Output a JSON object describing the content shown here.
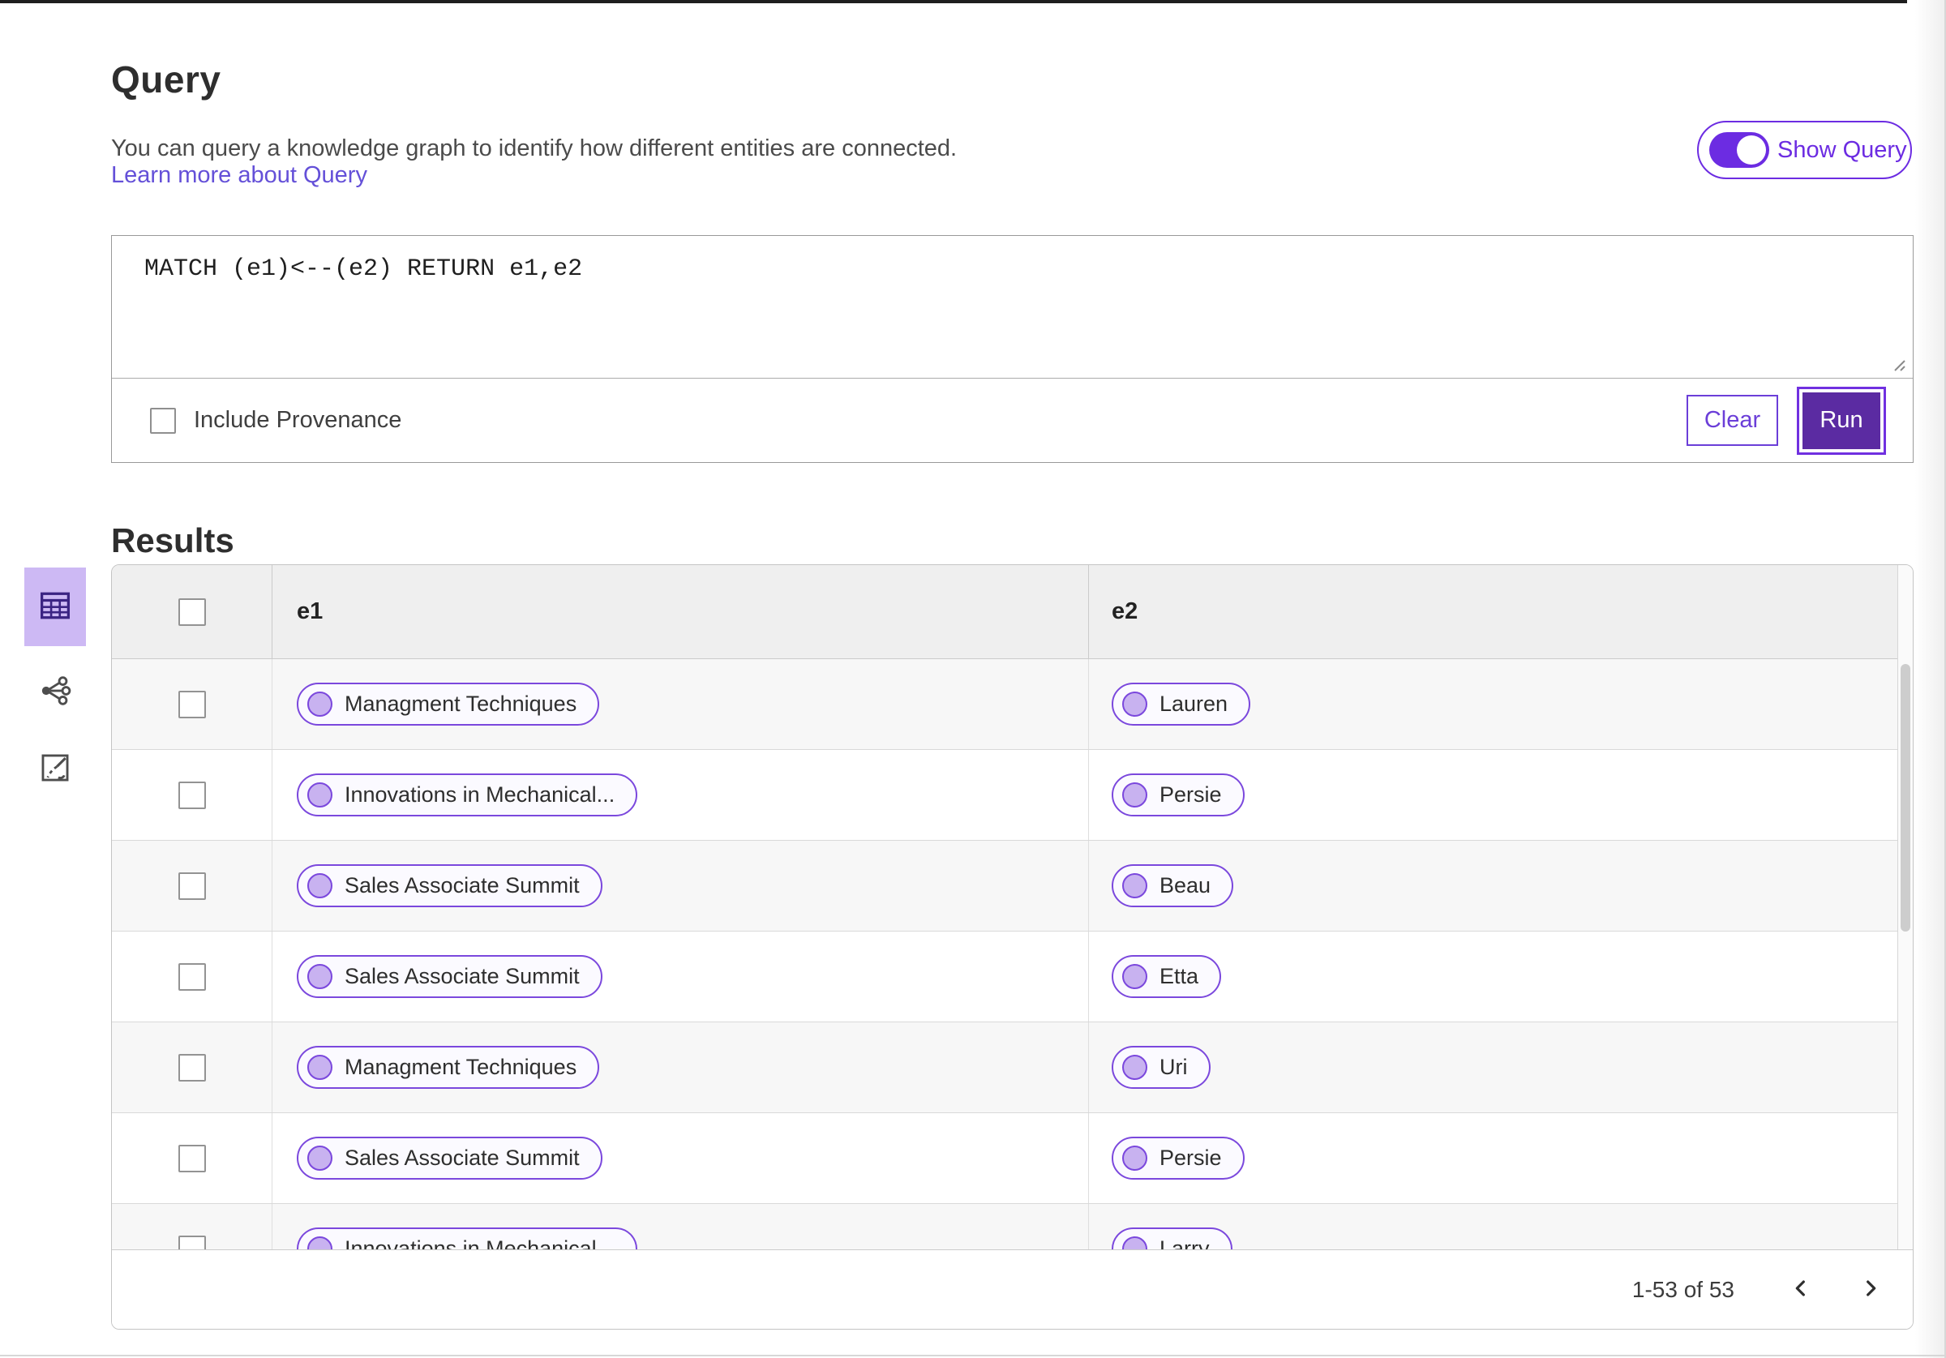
{
  "query_panel": {
    "title": "Query",
    "description": "You can query a knowledge graph to identify how different entities are connected.",
    "learn_more_link": "Learn more about Query",
    "show_query_toggle": {
      "label": "Show Query",
      "state": "on"
    },
    "editor_value": "MATCH (e1)<--(e2) RETURN e1,e2",
    "include_provenance": {
      "label": "Include Provenance",
      "checked": false
    },
    "buttons": {
      "clear": "Clear",
      "run": "Run"
    }
  },
  "results_panel": {
    "title": "Results",
    "view_switcher": [
      {
        "icon": "table-view-icon",
        "selected": true
      },
      {
        "icon": "graph-view-icon",
        "selected": false
      },
      {
        "icon": "export-view-icon",
        "selected": false
      }
    ],
    "table": {
      "select_all_checked": false,
      "columns": [
        "e1",
        "e2"
      ],
      "row_icon": "entity-circle-icon",
      "rows": [
        {
          "e1": "Managment Techniques",
          "e2": "Lauren"
        },
        {
          "e1": "Innovations in Mechanical...",
          "e2": "Persie"
        },
        {
          "e1": "Sales Associate Summit",
          "e2": "Beau"
        },
        {
          "e1": "Sales Associate Summit",
          "e2": "Etta"
        },
        {
          "e1": "Managment Techniques",
          "e2": "Uri"
        },
        {
          "e1": "Sales Associate Summit",
          "e2": "Persie"
        },
        {
          "e1": "Innovations in Mechanical...",
          "e2": "Larry"
        }
      ]
    },
    "pagination": {
      "range_label": "1-53 of 53",
      "prev_icon": "chevron-left-icon",
      "next_icon": "chevron-right-icon"
    }
  },
  "colors": {
    "accent_purple": "#6C2CE2",
    "run_button_fill": "#5B2BA2",
    "clear_button_border": "#6B3ED8",
    "link": "#6450D8",
    "selected_view_bg": "#CDB9F4",
    "table_icon": "#3B2483",
    "pill_border": "#7B48DD",
    "pill_circle_fill": "#C8B2F0",
    "header_row_bg": "#EFEFEF",
    "alt_row_bg": "#F7F7F7"
  }
}
